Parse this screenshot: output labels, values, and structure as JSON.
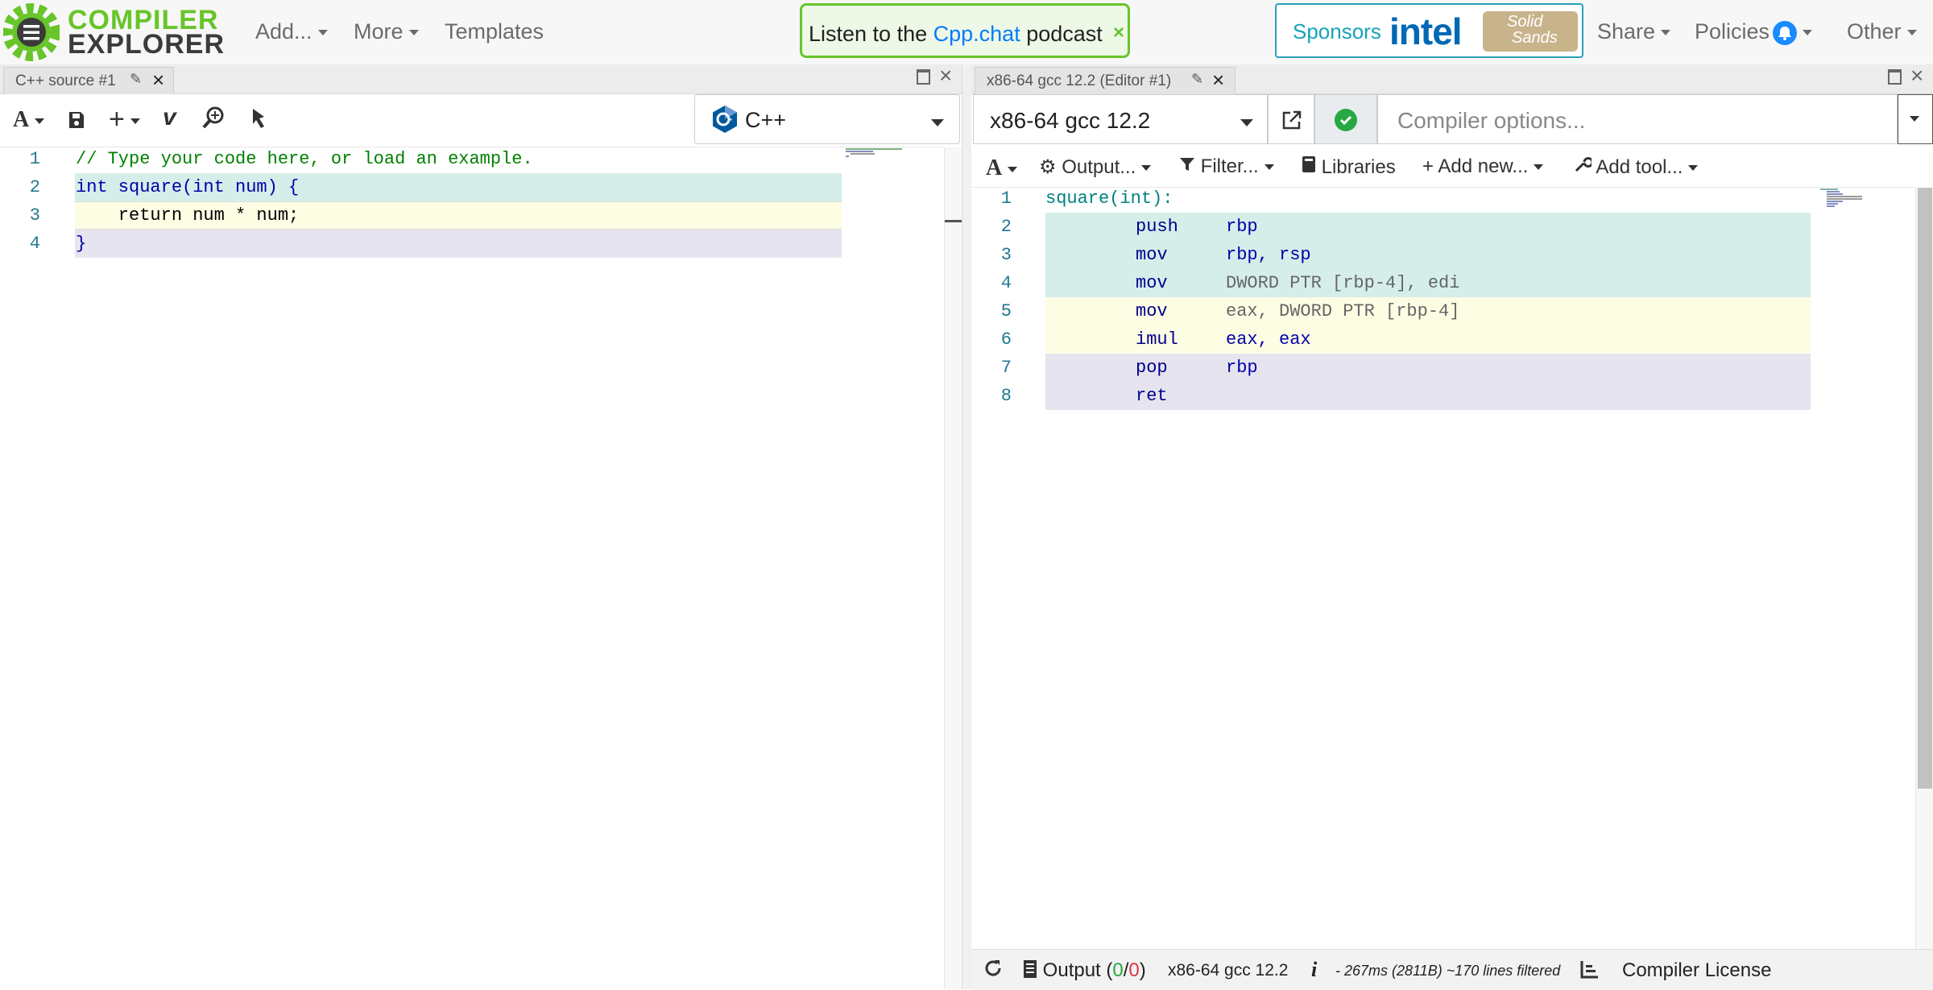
{
  "nav": {
    "logo_top": "COMPILER",
    "logo_bottom": "EXPLORER",
    "add": "Add...",
    "more": "More",
    "templates": "Templates",
    "banner_pre": "Listen to the",
    "banner_link": "Cpp.chat",
    "banner_post": "podcast",
    "banner_close": "×",
    "sponsors": "Sponsors",
    "sponsor_intel": "intel",
    "sponsor_solid": "Solid",
    "sponsor_sands": "Sands",
    "share": "Share",
    "policies": "Policies",
    "other": "Other"
  },
  "source": {
    "tab_title": "C++ source #1",
    "language": "C++",
    "line_numbers": [
      "1",
      "2",
      "3",
      "4"
    ],
    "lines": [
      "// Type your code here, or load an example.",
      "int square(int num) {",
      "    return num * num;",
      "}"
    ]
  },
  "compiler": {
    "tab_title": "x86-64 gcc 12.2 (Editor #1)",
    "name": "x86-64 gcc 12.2",
    "options_placeholder": "Compiler options...",
    "toolbar": {
      "font": "A",
      "output": "Output...",
      "filter": "Filter...",
      "libraries": "Libraries",
      "add_new": "Add new...",
      "add_tool": "Add tool..."
    },
    "line_numbers": [
      "1",
      "2",
      "3",
      "4",
      "5",
      "6",
      "7",
      "8"
    ],
    "asm": [
      {
        "label": "square(int):"
      },
      {
        "ins": "push",
        "ops": "rbp"
      },
      {
        "ins": "mov",
        "ops": "rbp, rsp"
      },
      {
        "ins": "mov",
        "ops": "DWORD PTR [rbp-4], edi"
      },
      {
        "ins": "mov",
        "ops": "eax, DWORD PTR [rbp-4]"
      },
      {
        "ins": "imul",
        "ops": "eax, eax"
      },
      {
        "ins": "pop",
        "ops": "rbp"
      },
      {
        "ins": "ret",
        "ops": ""
      }
    ]
  },
  "status": {
    "output_label": "Output (",
    "output_ok": "0",
    "output_sep": "/",
    "output_err": "0",
    "output_close": ")",
    "compiler": "x86-64 gcc 12.2",
    "info": "i",
    "timing": "- 267ms (2811B) ~170 lines filtered",
    "license": "Compiler License"
  },
  "colors": {
    "accent_green": "#67c52a",
    "link_blue": "#007bff",
    "line_teal": "#d5eeea",
    "line_yellow": "#fdfde4",
    "line_lavender": "#e6e5ef"
  }
}
